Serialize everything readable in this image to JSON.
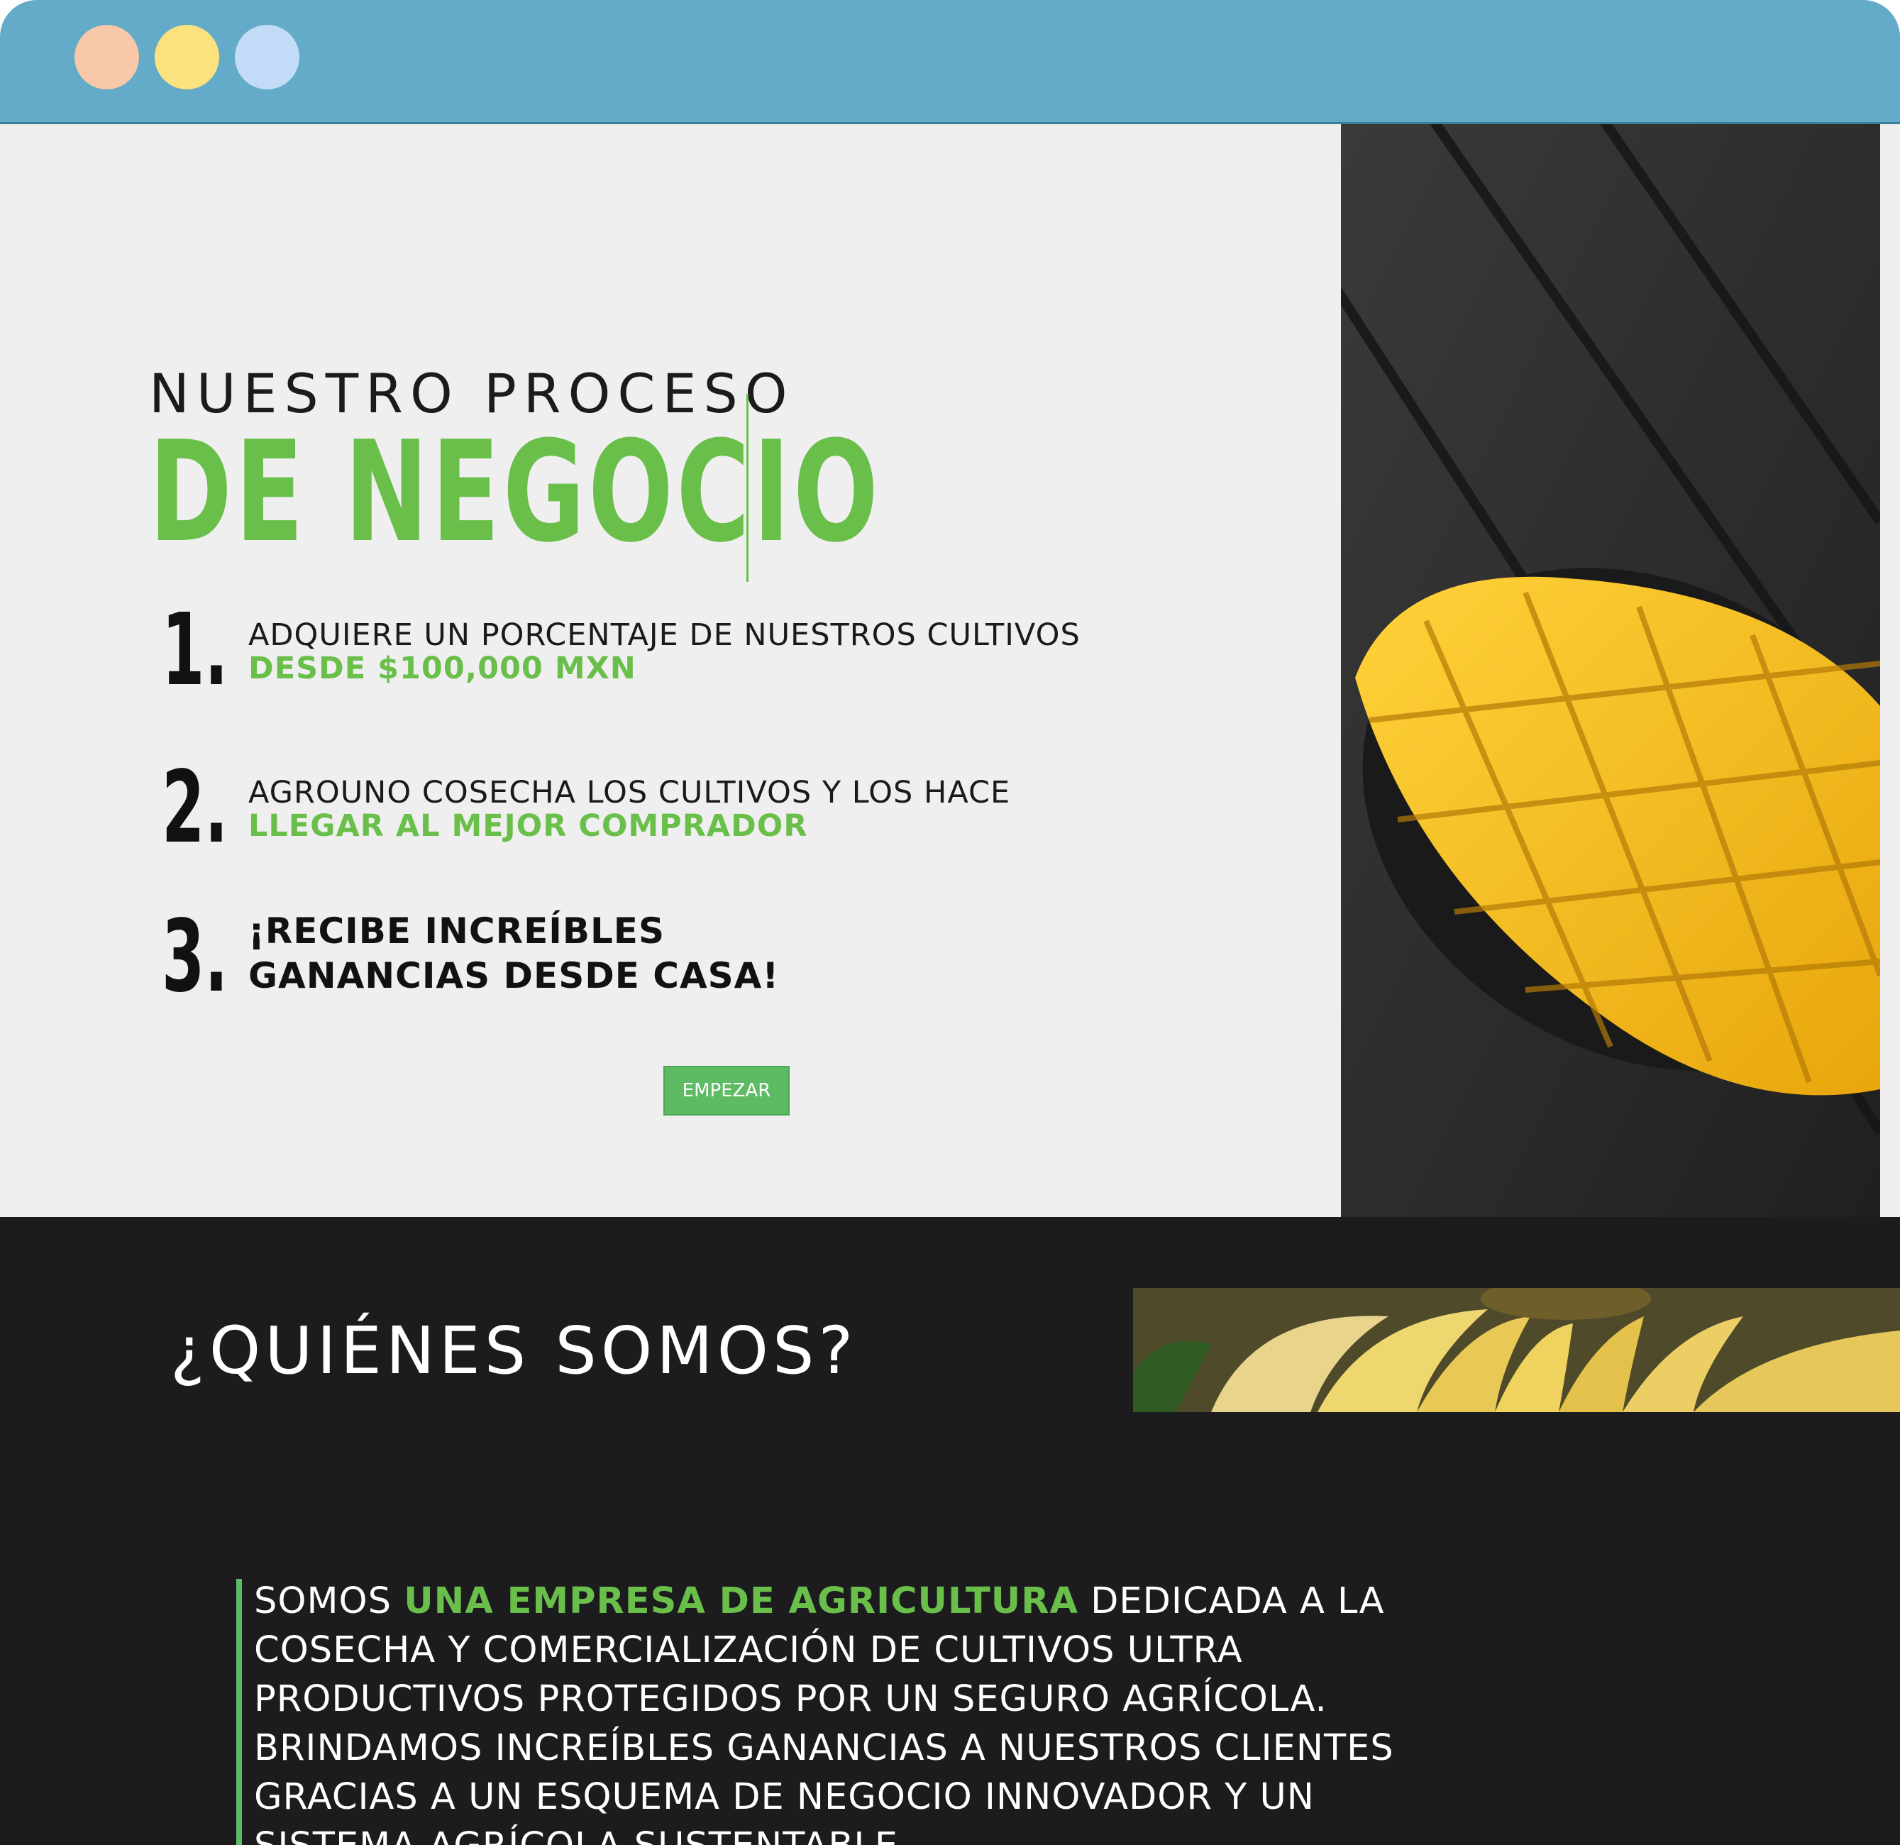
{
  "window": {
    "controls": [
      "close",
      "minimize",
      "maximize"
    ],
    "colors": {
      "titlebar": "#63abc8",
      "close": "#f8c8a8",
      "minimize": "#fbe27e",
      "maximize": "#c2dcf7"
    }
  },
  "hero": {
    "title_small": "NUESTRO PROCESO",
    "title_big": "DE NEGOCIO",
    "image": "mango-icon"
  },
  "steps": [
    {
      "number": "1.",
      "line1": "ADQUIERE UN PORCENTAJE DE NUESTROS CULTIVOS",
      "line2": "DESDE $100,000 MXN"
    },
    {
      "number": "2.",
      "line1": "AGROUNO COSECHA LOS CULTIVOS Y LOS HACE",
      "line2": "LLEGAR AL MEJOR COMPRADOR"
    },
    {
      "number": "3.",
      "line1": "¡RECIBE INCREÍBLES",
      "line2": "GANANCIAS DESDE CASA!"
    }
  ],
  "cta": {
    "label": "EMPEZAR"
  },
  "about": {
    "heading": "¿QUIÉNES SOMOS?",
    "image": "banana-icon",
    "intro": "SOMOS ",
    "highlight": "UNA EMPRESA DE AGRICULTURA",
    "rest": " DEDICADA A LA COSECHA Y COMERCIALIZACIÓN DE CULTIVOS ULTRA PRODUCTIVOS PROTEGIDOS POR UN SEGURO AGRÍCOLA. BRINDAMOS INCREÍBLES GANANCIAS A NUESTROS CLIENTES GRACIAS A UN ESQUEMA DE NEGOCIO INNOVADOR Y UN SISTEMA AGRÍCOLA SUSTENTABLE."
  },
  "colors": {
    "accent": "#6abf4b",
    "button": "#5dbb63",
    "dark_bg": "#1c1c1e",
    "light_bg": "#efefef"
  }
}
